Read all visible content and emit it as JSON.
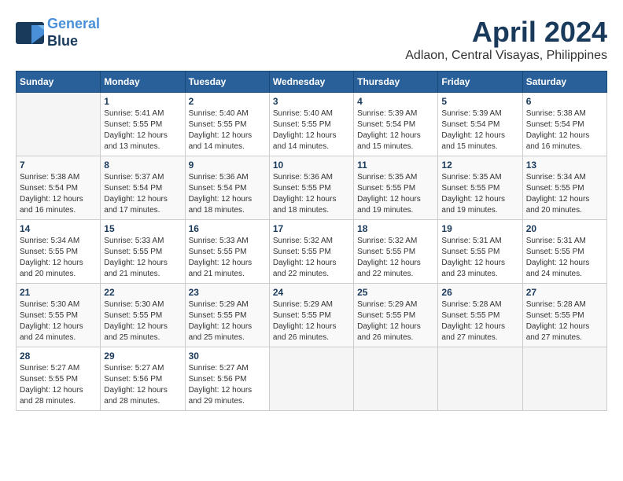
{
  "logo": {
    "line1": "General",
    "line2": "Blue"
  },
  "title": "April 2024",
  "location": "Adlaon, Central Visayas, Philippines",
  "days_of_week": [
    "Sunday",
    "Monday",
    "Tuesday",
    "Wednesday",
    "Thursday",
    "Friday",
    "Saturday"
  ],
  "weeks": [
    [
      {
        "day": "",
        "info": ""
      },
      {
        "day": "1",
        "info": "Sunrise: 5:41 AM\nSunset: 5:55 PM\nDaylight: 12 hours\nand 13 minutes."
      },
      {
        "day": "2",
        "info": "Sunrise: 5:40 AM\nSunset: 5:55 PM\nDaylight: 12 hours\nand 14 minutes."
      },
      {
        "day": "3",
        "info": "Sunrise: 5:40 AM\nSunset: 5:55 PM\nDaylight: 12 hours\nand 14 minutes."
      },
      {
        "day": "4",
        "info": "Sunrise: 5:39 AM\nSunset: 5:54 PM\nDaylight: 12 hours\nand 15 minutes."
      },
      {
        "day": "5",
        "info": "Sunrise: 5:39 AM\nSunset: 5:54 PM\nDaylight: 12 hours\nand 15 minutes."
      },
      {
        "day": "6",
        "info": "Sunrise: 5:38 AM\nSunset: 5:54 PM\nDaylight: 12 hours\nand 16 minutes."
      }
    ],
    [
      {
        "day": "7",
        "info": "Sunrise: 5:38 AM\nSunset: 5:54 PM\nDaylight: 12 hours\nand 16 minutes."
      },
      {
        "day": "8",
        "info": "Sunrise: 5:37 AM\nSunset: 5:54 PM\nDaylight: 12 hours\nand 17 minutes."
      },
      {
        "day": "9",
        "info": "Sunrise: 5:36 AM\nSunset: 5:54 PM\nDaylight: 12 hours\nand 18 minutes."
      },
      {
        "day": "10",
        "info": "Sunrise: 5:36 AM\nSunset: 5:55 PM\nDaylight: 12 hours\nand 18 minutes."
      },
      {
        "day": "11",
        "info": "Sunrise: 5:35 AM\nSunset: 5:55 PM\nDaylight: 12 hours\nand 19 minutes."
      },
      {
        "day": "12",
        "info": "Sunrise: 5:35 AM\nSunset: 5:55 PM\nDaylight: 12 hours\nand 19 minutes."
      },
      {
        "day": "13",
        "info": "Sunrise: 5:34 AM\nSunset: 5:55 PM\nDaylight: 12 hours\nand 20 minutes."
      }
    ],
    [
      {
        "day": "14",
        "info": "Sunrise: 5:34 AM\nSunset: 5:55 PM\nDaylight: 12 hours\nand 20 minutes."
      },
      {
        "day": "15",
        "info": "Sunrise: 5:33 AM\nSunset: 5:55 PM\nDaylight: 12 hours\nand 21 minutes."
      },
      {
        "day": "16",
        "info": "Sunrise: 5:33 AM\nSunset: 5:55 PM\nDaylight: 12 hours\nand 21 minutes."
      },
      {
        "day": "17",
        "info": "Sunrise: 5:32 AM\nSunset: 5:55 PM\nDaylight: 12 hours\nand 22 minutes."
      },
      {
        "day": "18",
        "info": "Sunrise: 5:32 AM\nSunset: 5:55 PM\nDaylight: 12 hours\nand 22 minutes."
      },
      {
        "day": "19",
        "info": "Sunrise: 5:31 AM\nSunset: 5:55 PM\nDaylight: 12 hours\nand 23 minutes."
      },
      {
        "day": "20",
        "info": "Sunrise: 5:31 AM\nSunset: 5:55 PM\nDaylight: 12 hours\nand 24 minutes."
      }
    ],
    [
      {
        "day": "21",
        "info": "Sunrise: 5:30 AM\nSunset: 5:55 PM\nDaylight: 12 hours\nand 24 minutes."
      },
      {
        "day": "22",
        "info": "Sunrise: 5:30 AM\nSunset: 5:55 PM\nDaylight: 12 hours\nand 25 minutes."
      },
      {
        "day": "23",
        "info": "Sunrise: 5:29 AM\nSunset: 5:55 PM\nDaylight: 12 hours\nand 25 minutes."
      },
      {
        "day": "24",
        "info": "Sunrise: 5:29 AM\nSunset: 5:55 PM\nDaylight: 12 hours\nand 26 minutes."
      },
      {
        "day": "25",
        "info": "Sunrise: 5:29 AM\nSunset: 5:55 PM\nDaylight: 12 hours\nand 26 minutes."
      },
      {
        "day": "26",
        "info": "Sunrise: 5:28 AM\nSunset: 5:55 PM\nDaylight: 12 hours\nand 27 minutes."
      },
      {
        "day": "27",
        "info": "Sunrise: 5:28 AM\nSunset: 5:55 PM\nDaylight: 12 hours\nand 27 minutes."
      }
    ],
    [
      {
        "day": "28",
        "info": "Sunrise: 5:27 AM\nSunset: 5:55 PM\nDaylight: 12 hours\nand 28 minutes."
      },
      {
        "day": "29",
        "info": "Sunrise: 5:27 AM\nSunset: 5:56 PM\nDaylight: 12 hours\nand 28 minutes."
      },
      {
        "day": "30",
        "info": "Sunrise: 5:27 AM\nSunset: 5:56 PM\nDaylight: 12 hours\nand 29 minutes."
      },
      {
        "day": "",
        "info": ""
      },
      {
        "day": "",
        "info": ""
      },
      {
        "day": "",
        "info": ""
      },
      {
        "day": "",
        "info": ""
      }
    ]
  ]
}
